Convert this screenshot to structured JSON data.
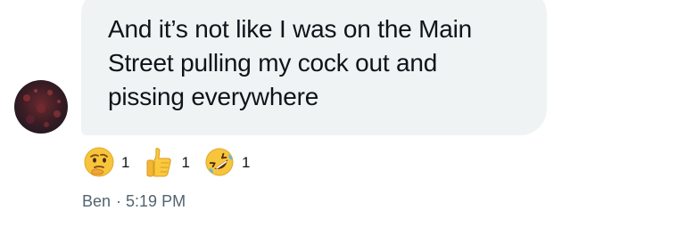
{
  "message": {
    "text": "And it’s not like I was on the Main\nStreet pulling my cock out and\npissing everywhere"
  },
  "avatar": {
    "icon": "user-avatar"
  },
  "reactions": [
    {
      "emoji": "thinking-face",
      "count": "1"
    },
    {
      "emoji": "thumbs-up",
      "count": "1"
    },
    {
      "emoji": "rolling-on-floor-laughing",
      "count": "1"
    }
  ],
  "meta": {
    "sender": "Ben",
    "separator": "·",
    "time": "5:19 PM"
  },
  "colors": {
    "bubble_bg": "#eff3f4",
    "text": "#0f1419",
    "meta_text": "#536471"
  }
}
